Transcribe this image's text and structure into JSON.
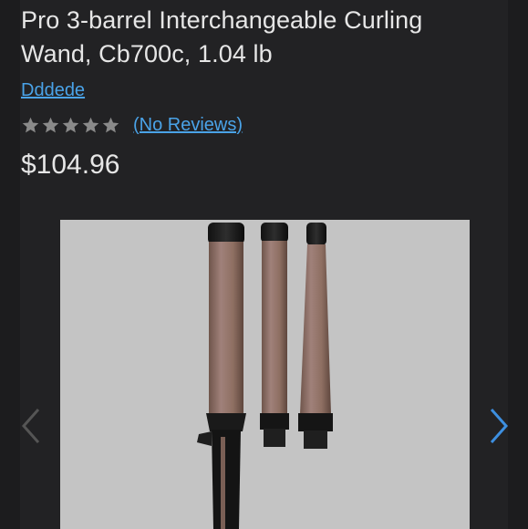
{
  "product": {
    "title": "Pro 3-barrel Interchangeable Curling Wand, Cb700c, 1.04 lb",
    "brand": "Dddede",
    "rating_stars": 5,
    "rating_filled": 0,
    "reviews_label": "(No Reviews)",
    "price": "$104.96"
  },
  "gallery": {
    "image_icon": "curling-wand-set-photo",
    "prev_icon": "chevron-left-icon",
    "next_icon": "chevron-right-icon"
  },
  "colors": {
    "link": "#4aa3e8",
    "text": "#e6e6e6",
    "star_empty": "#8a8a8a",
    "next_arrow": "#3d8fe0",
    "prev_arrow": "#555555",
    "image_bg": "#c4c4c4",
    "barrel": "#8e6f62"
  }
}
